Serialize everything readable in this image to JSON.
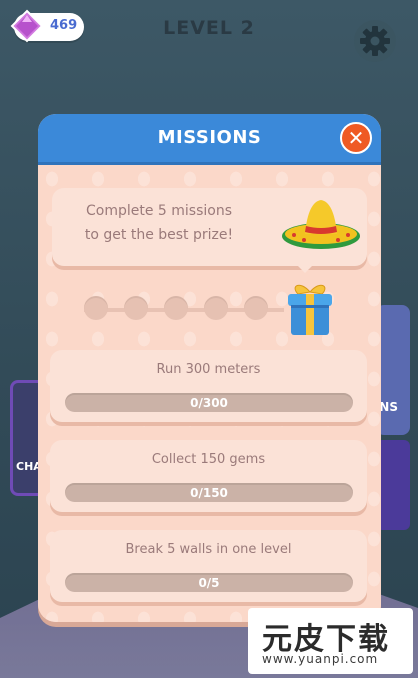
{
  "hud": {
    "gem_count": "469",
    "level_label": "LEVEL 2",
    "settings_icon": "gear-icon"
  },
  "background": {
    "left_panel_label": "CHA",
    "right_panel_label": "ONS"
  },
  "modal": {
    "title": "MISSIONS",
    "close_glyph": "✕",
    "intro_line1": "Complete 5 missions",
    "intro_line2": "to get the best prize!",
    "prize_icon": "gift-box-icon",
    "reward_icon": "sombrero-icon",
    "progress_completed": 0,
    "progress_total": 5
  },
  "missions": [
    {
      "title": "Run 300 meters",
      "progress": "0/300"
    },
    {
      "title": "Collect 150 gems",
      "progress": "0/150"
    },
    {
      "title": "Break 5 walls in one level",
      "progress": "0/5"
    }
  ],
  "watermark": {
    "main": "元皮下载",
    "url": "www.yuanpi.com"
  },
  "colors": {
    "header_blue": "#3b89d9",
    "close_orange": "#ef5a24",
    "panel_peach": "#fbd8c9",
    "gem_purple": "#c86ad8"
  }
}
